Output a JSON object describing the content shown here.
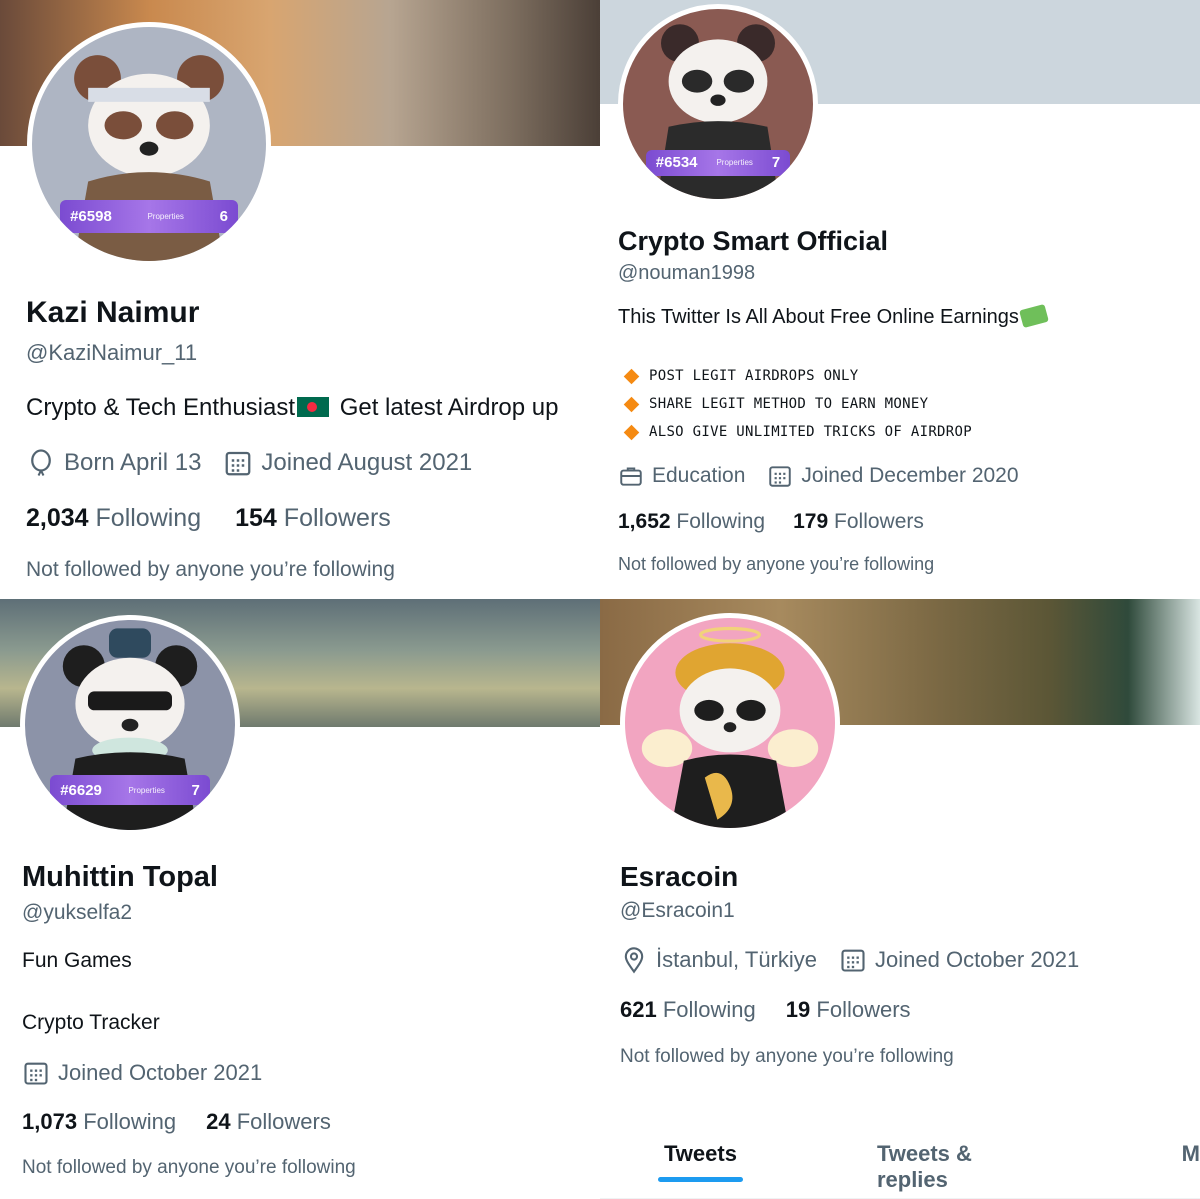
{
  "profiles": [
    {
      "display_name": "Kazi Naimur",
      "handle": "@KaziNaimur_11",
      "bio_part1": "Crypto & Tech Enthusiast",
      "bio_part2": " Get latest Airdrop up",
      "nft_id": "#6598",
      "nft_props_label": "Properties",
      "nft_props_count": "6",
      "meta": [
        {
          "icon": "balloon-icon",
          "text": "Born April 13"
        },
        {
          "icon": "calendar-icon",
          "text": "Joined August 2021"
        }
      ],
      "following_count": "2,034",
      "following_label": "Following",
      "followers_count": "154",
      "followers_label": "Followers",
      "not_followed": "Not followed by anyone you’re following"
    },
    {
      "display_name": "Crypto Smart Official",
      "handle": "@nouman1998",
      "bio": "This Twitter Is All About Free Online Earnings",
      "bio_list": [
        "POST LEGIT AIRDROPS ONLY",
        "SHARE LEGIT METHOD TO EARN MONEY",
        "ALSO GIVE UNLIMITED TRICKS OF AIRDROP"
      ],
      "nft_id": "#6534",
      "nft_props_label": "Properties",
      "nft_props_count": "7",
      "meta": [
        {
          "icon": "briefcase-icon",
          "text": "Education"
        },
        {
          "icon": "calendar-icon",
          "text": "Joined December 2020"
        }
      ],
      "following_count": "1,652",
      "following_label": "Following",
      "followers_count": "179",
      "followers_label": "Followers",
      "not_followed": "Not followed by anyone you’re following"
    },
    {
      "display_name": "Muhittin Topal",
      "handle": "@yukselfa2",
      "bio_line1": "Fun Games",
      "bio_line2": "Crypto Tracker",
      "nft_id": "#6629",
      "nft_props_label": "Properties",
      "nft_props_count": "7",
      "meta": [
        {
          "icon": "calendar-icon",
          "text": "Joined October 2021"
        }
      ],
      "following_count": "1,073",
      "following_label": "Following",
      "followers_count": "24",
      "followers_label": "Followers",
      "not_followed": "Not followed by anyone you’re following"
    },
    {
      "display_name": "Esracoin",
      "handle": "@Esracoin1",
      "meta": [
        {
          "icon": "location-icon",
          "text": "İstanbul, Türkiye"
        },
        {
          "icon": "calendar-icon",
          "text": "Joined October 2021"
        }
      ],
      "following_count": "621",
      "following_label": "Following",
      "followers_count": "19",
      "followers_label": "Followers",
      "not_followed": "Not followed by anyone you’re following",
      "tabs": [
        "Tweets",
        "Tweets & replies",
        "M"
      ]
    }
  ],
  "colors": {
    "text": "#0f1419",
    "secondary": "#536471",
    "accent": "#1d9bf0",
    "diamond": "#f58a12"
  }
}
